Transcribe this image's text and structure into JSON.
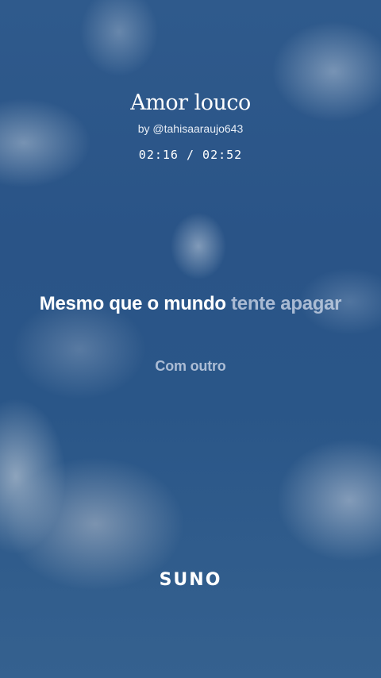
{
  "song": {
    "title": "Amor louco",
    "artist": "by @tahisaaraujo643"
  },
  "playback": {
    "current_time": "02:16",
    "separator": "/",
    "total_time": "02:52"
  },
  "lyrics": {
    "current_line_sung": "Mesmo que o mundo",
    "current_line_pending": "tente apagar",
    "next_line": "Com outro"
  },
  "brand": {
    "logo_text": "SUNO"
  },
  "colors": {
    "sky": "#2a5487",
    "text_primary": "#ffffff",
    "text_dimmed": "#cdd7e8"
  }
}
